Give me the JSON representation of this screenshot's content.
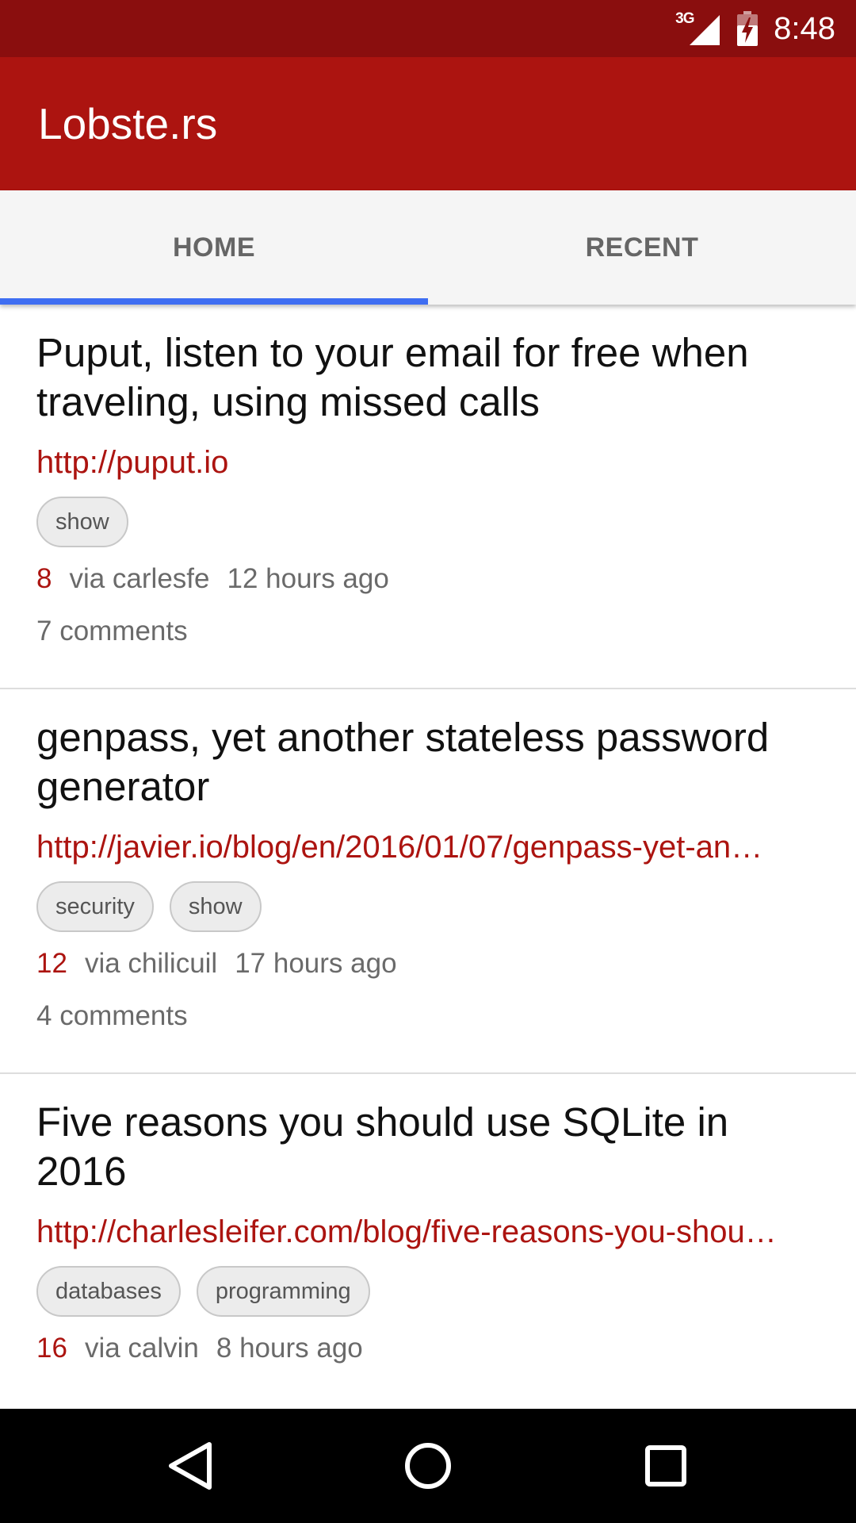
{
  "status_bar": {
    "network": "3G",
    "time": "8:48",
    "icons": [
      "signal-icon",
      "battery-charging-icon"
    ]
  },
  "app_bar": {
    "title": "Lobste.rs"
  },
  "tabs": [
    {
      "label": "HOME",
      "selected": true
    },
    {
      "label": "RECENT",
      "selected": false
    }
  ],
  "colors": {
    "status_bar": "#8a0e0e",
    "app_bar": "#ac1410",
    "tab_indicator": "#3f6ef2",
    "link": "#ac1410",
    "score": "#ac1410"
  },
  "stories": [
    {
      "title": "Puput, listen to your email for free when traveling, using missed calls",
      "url": "http://puput.io",
      "tags": [
        "show"
      ],
      "score": "8",
      "via": "via carlesfe",
      "time": "12 hours ago",
      "comments": "7 comments"
    },
    {
      "title": "genpass, yet another stateless password generator",
      "url": "http://javier.io/blog/en/2016/01/07/genpass-yet-an…",
      "tags": [
        "security",
        "show"
      ],
      "score": "12",
      "via": "via chilicuil",
      "time": "17 hours ago",
      "comments": "4 comments"
    },
    {
      "title": "Five reasons you should use SQLite in 2016",
      "url": "http://charlesleifer.com/blog/five-reasons-you-shou…",
      "tags": [
        "databases",
        "programming"
      ],
      "score": "16",
      "via": "via calvin",
      "time": "8 hours ago"
    }
  ],
  "nav_bar": {
    "icons": [
      "back-icon",
      "home-icon",
      "recents-icon"
    ]
  }
}
